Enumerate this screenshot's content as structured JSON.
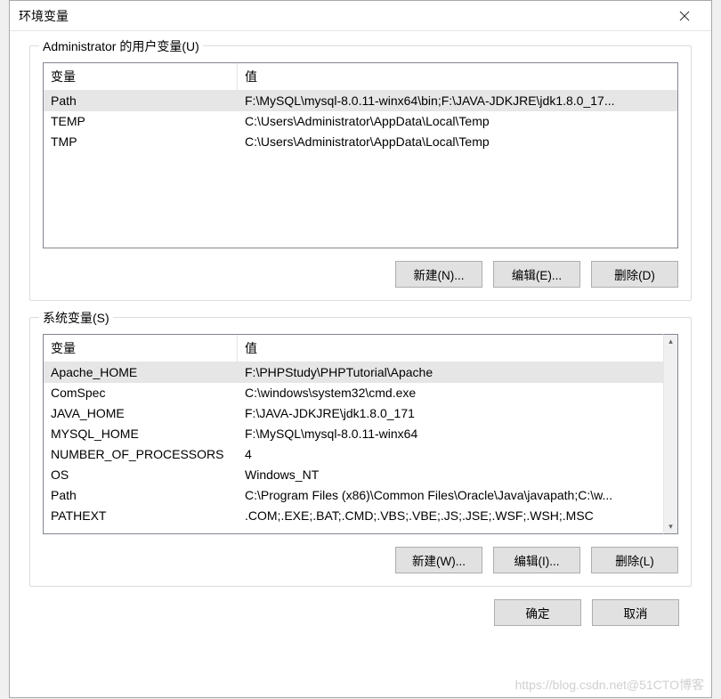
{
  "window": {
    "title": "环境变量"
  },
  "userSection": {
    "label": "Administrator 的用户变量(U)",
    "columns": {
      "var": "变量",
      "val": "值"
    },
    "rows": [
      {
        "var": "Path",
        "val": "F:\\MySQL\\mysql-8.0.11-winx64\\bin;F:\\JAVA-JDKJRE\\jdk1.8.0_17...",
        "selected": true
      },
      {
        "var": "TEMP",
        "val": "C:\\Users\\Administrator\\AppData\\Local\\Temp",
        "selected": false
      },
      {
        "var": "TMP",
        "val": "C:\\Users\\Administrator\\AppData\\Local\\Temp",
        "selected": false
      }
    ],
    "buttons": {
      "new": "新建(N)...",
      "edit": "编辑(E)...",
      "delete": "删除(D)"
    }
  },
  "sysSection": {
    "label": "系统变量(S)",
    "columns": {
      "var": "变量",
      "val": "值"
    },
    "rows": [
      {
        "var": "Apache_HOME",
        "val": "F:\\PHPStudy\\PHPTutorial\\Apache",
        "selected": true
      },
      {
        "var": "ComSpec",
        "val": "C:\\windows\\system32\\cmd.exe",
        "selected": false
      },
      {
        "var": "JAVA_HOME",
        "val": "F:\\JAVA-JDKJRE\\jdk1.8.0_171",
        "selected": false
      },
      {
        "var": "MYSQL_HOME",
        "val": "F:\\MySQL\\mysql-8.0.11-winx64",
        "selected": false
      },
      {
        "var": "NUMBER_OF_PROCESSORS",
        "val": "4",
        "selected": false
      },
      {
        "var": "OS",
        "val": "Windows_NT",
        "selected": false
      },
      {
        "var": "Path",
        "val": "C:\\Program Files (x86)\\Common Files\\Oracle\\Java\\javapath;C:\\w...",
        "selected": false
      },
      {
        "var": "PATHEXT",
        "val": ".COM;.EXE;.BAT;.CMD;.VBS;.VBE;.JS;.JSE;.WSF;.WSH;.MSC",
        "selected": false
      }
    ],
    "buttons": {
      "new": "新建(W)...",
      "edit": "编辑(I)...",
      "delete": "删除(L)"
    }
  },
  "footer": {
    "ok": "确定",
    "cancel": "取消"
  },
  "watermark": "https://blog.csdn.net@51CTO博客"
}
